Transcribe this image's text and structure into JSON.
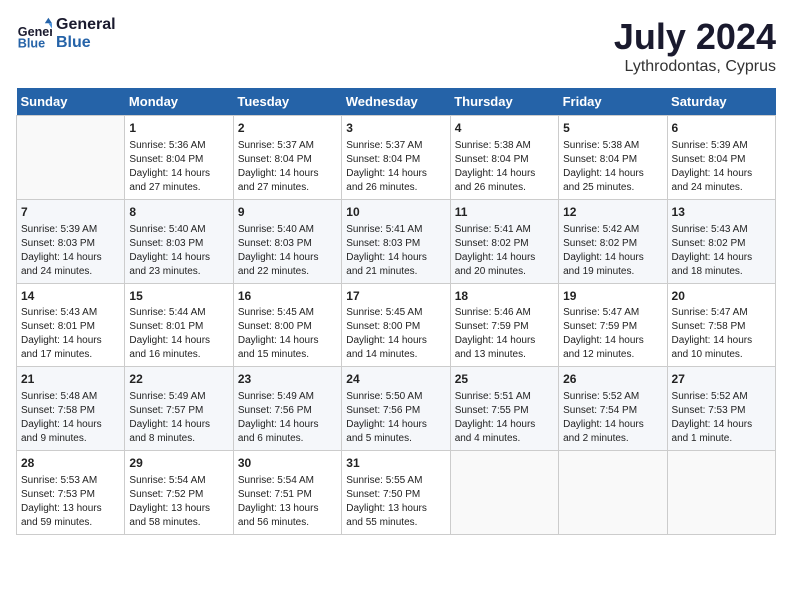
{
  "logo": {
    "line1": "General",
    "line2": "Blue"
  },
  "title": "July 2024",
  "location": "Lythrodontas, Cyprus",
  "days_header": [
    "Sunday",
    "Monday",
    "Tuesday",
    "Wednesday",
    "Thursday",
    "Friday",
    "Saturday"
  ],
  "weeks": [
    [
      {
        "day": "",
        "info": ""
      },
      {
        "day": "1",
        "info": "Sunrise: 5:36 AM\nSunset: 8:04 PM\nDaylight: 14 hours\nand 27 minutes."
      },
      {
        "day": "2",
        "info": "Sunrise: 5:37 AM\nSunset: 8:04 PM\nDaylight: 14 hours\nand 27 minutes."
      },
      {
        "day": "3",
        "info": "Sunrise: 5:37 AM\nSunset: 8:04 PM\nDaylight: 14 hours\nand 26 minutes."
      },
      {
        "day": "4",
        "info": "Sunrise: 5:38 AM\nSunset: 8:04 PM\nDaylight: 14 hours\nand 26 minutes."
      },
      {
        "day": "5",
        "info": "Sunrise: 5:38 AM\nSunset: 8:04 PM\nDaylight: 14 hours\nand 25 minutes."
      },
      {
        "day": "6",
        "info": "Sunrise: 5:39 AM\nSunset: 8:04 PM\nDaylight: 14 hours\nand 24 minutes."
      }
    ],
    [
      {
        "day": "7",
        "info": "Sunrise: 5:39 AM\nSunset: 8:03 PM\nDaylight: 14 hours\nand 24 minutes."
      },
      {
        "day": "8",
        "info": "Sunrise: 5:40 AM\nSunset: 8:03 PM\nDaylight: 14 hours\nand 23 minutes."
      },
      {
        "day": "9",
        "info": "Sunrise: 5:40 AM\nSunset: 8:03 PM\nDaylight: 14 hours\nand 22 minutes."
      },
      {
        "day": "10",
        "info": "Sunrise: 5:41 AM\nSunset: 8:03 PM\nDaylight: 14 hours\nand 21 minutes."
      },
      {
        "day": "11",
        "info": "Sunrise: 5:41 AM\nSunset: 8:02 PM\nDaylight: 14 hours\nand 20 minutes."
      },
      {
        "day": "12",
        "info": "Sunrise: 5:42 AM\nSunset: 8:02 PM\nDaylight: 14 hours\nand 19 minutes."
      },
      {
        "day": "13",
        "info": "Sunrise: 5:43 AM\nSunset: 8:02 PM\nDaylight: 14 hours\nand 18 minutes."
      }
    ],
    [
      {
        "day": "14",
        "info": "Sunrise: 5:43 AM\nSunset: 8:01 PM\nDaylight: 14 hours\nand 17 minutes."
      },
      {
        "day": "15",
        "info": "Sunrise: 5:44 AM\nSunset: 8:01 PM\nDaylight: 14 hours\nand 16 minutes."
      },
      {
        "day": "16",
        "info": "Sunrise: 5:45 AM\nSunset: 8:00 PM\nDaylight: 14 hours\nand 15 minutes."
      },
      {
        "day": "17",
        "info": "Sunrise: 5:45 AM\nSunset: 8:00 PM\nDaylight: 14 hours\nand 14 minutes."
      },
      {
        "day": "18",
        "info": "Sunrise: 5:46 AM\nSunset: 7:59 PM\nDaylight: 14 hours\nand 13 minutes."
      },
      {
        "day": "19",
        "info": "Sunrise: 5:47 AM\nSunset: 7:59 PM\nDaylight: 14 hours\nand 12 minutes."
      },
      {
        "day": "20",
        "info": "Sunrise: 5:47 AM\nSunset: 7:58 PM\nDaylight: 14 hours\nand 10 minutes."
      }
    ],
    [
      {
        "day": "21",
        "info": "Sunrise: 5:48 AM\nSunset: 7:58 PM\nDaylight: 14 hours\nand 9 minutes."
      },
      {
        "day": "22",
        "info": "Sunrise: 5:49 AM\nSunset: 7:57 PM\nDaylight: 14 hours\nand 8 minutes."
      },
      {
        "day": "23",
        "info": "Sunrise: 5:49 AM\nSunset: 7:56 PM\nDaylight: 14 hours\nand 6 minutes."
      },
      {
        "day": "24",
        "info": "Sunrise: 5:50 AM\nSunset: 7:56 PM\nDaylight: 14 hours\nand 5 minutes."
      },
      {
        "day": "25",
        "info": "Sunrise: 5:51 AM\nSunset: 7:55 PM\nDaylight: 14 hours\nand 4 minutes."
      },
      {
        "day": "26",
        "info": "Sunrise: 5:52 AM\nSunset: 7:54 PM\nDaylight: 14 hours\nand 2 minutes."
      },
      {
        "day": "27",
        "info": "Sunrise: 5:52 AM\nSunset: 7:53 PM\nDaylight: 14 hours\nand 1 minute."
      }
    ],
    [
      {
        "day": "28",
        "info": "Sunrise: 5:53 AM\nSunset: 7:53 PM\nDaylight: 13 hours\nand 59 minutes."
      },
      {
        "day": "29",
        "info": "Sunrise: 5:54 AM\nSunset: 7:52 PM\nDaylight: 13 hours\nand 58 minutes."
      },
      {
        "day": "30",
        "info": "Sunrise: 5:54 AM\nSunset: 7:51 PM\nDaylight: 13 hours\nand 56 minutes."
      },
      {
        "day": "31",
        "info": "Sunrise: 5:55 AM\nSunset: 7:50 PM\nDaylight: 13 hours\nand 55 minutes."
      },
      {
        "day": "",
        "info": ""
      },
      {
        "day": "",
        "info": ""
      },
      {
        "day": "",
        "info": ""
      }
    ]
  ]
}
